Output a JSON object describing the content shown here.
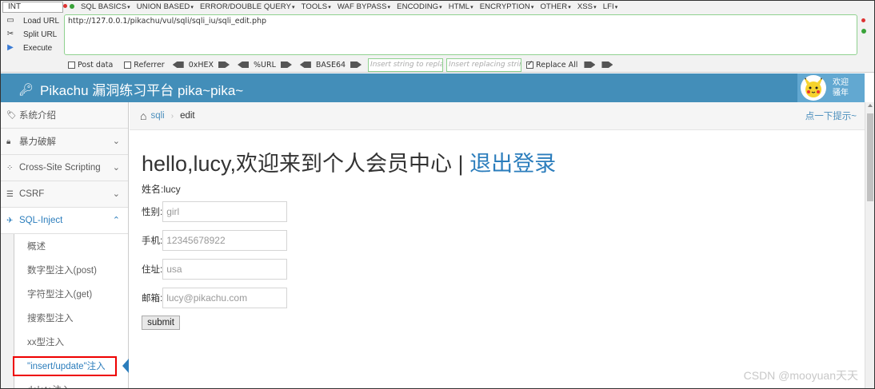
{
  "hackbar": {
    "type_select": "INT",
    "menus": [
      "SQL BASICS",
      "UNION BASED",
      "ERROR/DOUBLE QUERY",
      "TOOLS",
      "WAF BYPASS",
      "ENCODING",
      "HTML",
      "ENCRYPTION",
      "OTHER",
      "XSS",
      "LFI"
    ],
    "load_url": "Load URL",
    "split_url": "Split URL",
    "execute": "Execute",
    "url": "http://127.0.0.1/pikachu/vul/sqli/sqli_iu/sqli_edit.php",
    "post_data": "Post data",
    "referrer": "Referrer",
    "hex": "0xHEX",
    "url_enc": "%URL",
    "base64": "BASE64",
    "insert_placeholder": "Insert string to replace",
    "replacing_placeholder": "Insert replacing string",
    "replace_all": "Replace All",
    "replace_all_checked": true
  },
  "header": {
    "title": "Pikachu 漏洞练习平台 pika~pika~",
    "welcome_line1": "欢迎",
    "welcome_line2": "骚年"
  },
  "sidebar": {
    "items": [
      {
        "label": "系统介绍",
        "icon": "tag-icon"
      },
      {
        "label": "暴力破解",
        "icon": "lock-icon"
      },
      {
        "label": "Cross-Site Scripting",
        "icon": "xss-icon"
      },
      {
        "label": "CSRF",
        "icon": "list-icon"
      },
      {
        "label": "SQL-Inject",
        "icon": "plane-icon"
      }
    ],
    "subitems": [
      "概述",
      "数字型注入(post)",
      "字符型注入(get)",
      "搜索型注入",
      "xx型注入",
      "\"insert/update\"注入",
      "delete注入"
    ]
  },
  "breadcrumb": {
    "link": "sqli",
    "current": "edit",
    "hint": "点一下提示~"
  },
  "main": {
    "greeting": "hello,lucy,欢迎来到个人会员中心 | ",
    "logout": "退出登录",
    "name_label": "姓名:",
    "name_value": "lucy",
    "sex_label": "性别:",
    "sex_value": "girl",
    "phone_label": "手机:",
    "phone_value": "12345678922",
    "addr_label": "住址:",
    "addr_value": "usa",
    "email_label": "邮箱:",
    "email_value": "lucy@pikachu.com",
    "submit": "submit"
  },
  "watermark": "CSDN @mooyuan天天"
}
